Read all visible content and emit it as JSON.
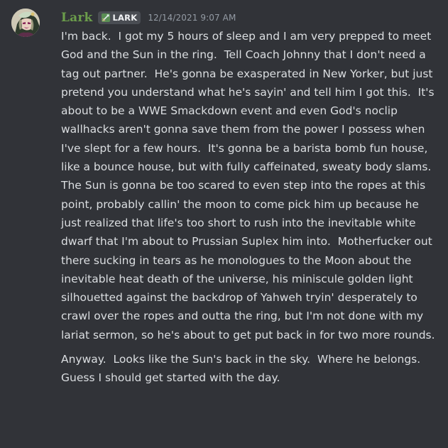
{
  "message": {
    "author": {
      "name": "Lark",
      "name_color": "#6b9d4b",
      "tag_icon": "sword-icon",
      "tag_label": "LARK"
    },
    "timestamp": "12/14/2021 9:07 AM",
    "paragraphs": [
      "I'm back.  I got my 5 hours of sleep and I am very prepped to meet God and the Sun in the ring.  Tell Coach Johnny that I don't need a tag out partner.  He's gonna be exasperated in New Yorker, but just pretend you understand what he's sayin' and tell him I got this.  It's about to be a WWE Smackdown event and even God's noclip wallhacks aren't gonna save them from the power I possess when I've slept for a few hours.  It's gonna be a barista bomb fun house, like a bounce house, but with fully caffeinated, sweaty body slams.  The Sun is gonna be too scared to even step into the ropes at this point, probably callin' the moon to come pick him up because he just realized that life's too short to rush into the inevitable white dwarf that I'm about to Prussian Suplex him into.  Motherfucker out there sucking in tears as he monologues to the Moon about the inevitable heat death of the universe, his miniscule golden light silhouetted against the backdrop of Yahweh tryin' desperately to crawl over the ropes and outta the ring, but I'm not done with my lariat sermon, so he's about to get put back in for two more rounds.",
      "Anyway.  Looks like the Sun's back in the sky.  Where he belongs.  Guess I should get started with the day."
    ]
  },
  "colors": {
    "background": "#313338",
    "text": "#dbdee1",
    "timestamp": "#949ba4",
    "tag_background": "#4a4d53"
  }
}
